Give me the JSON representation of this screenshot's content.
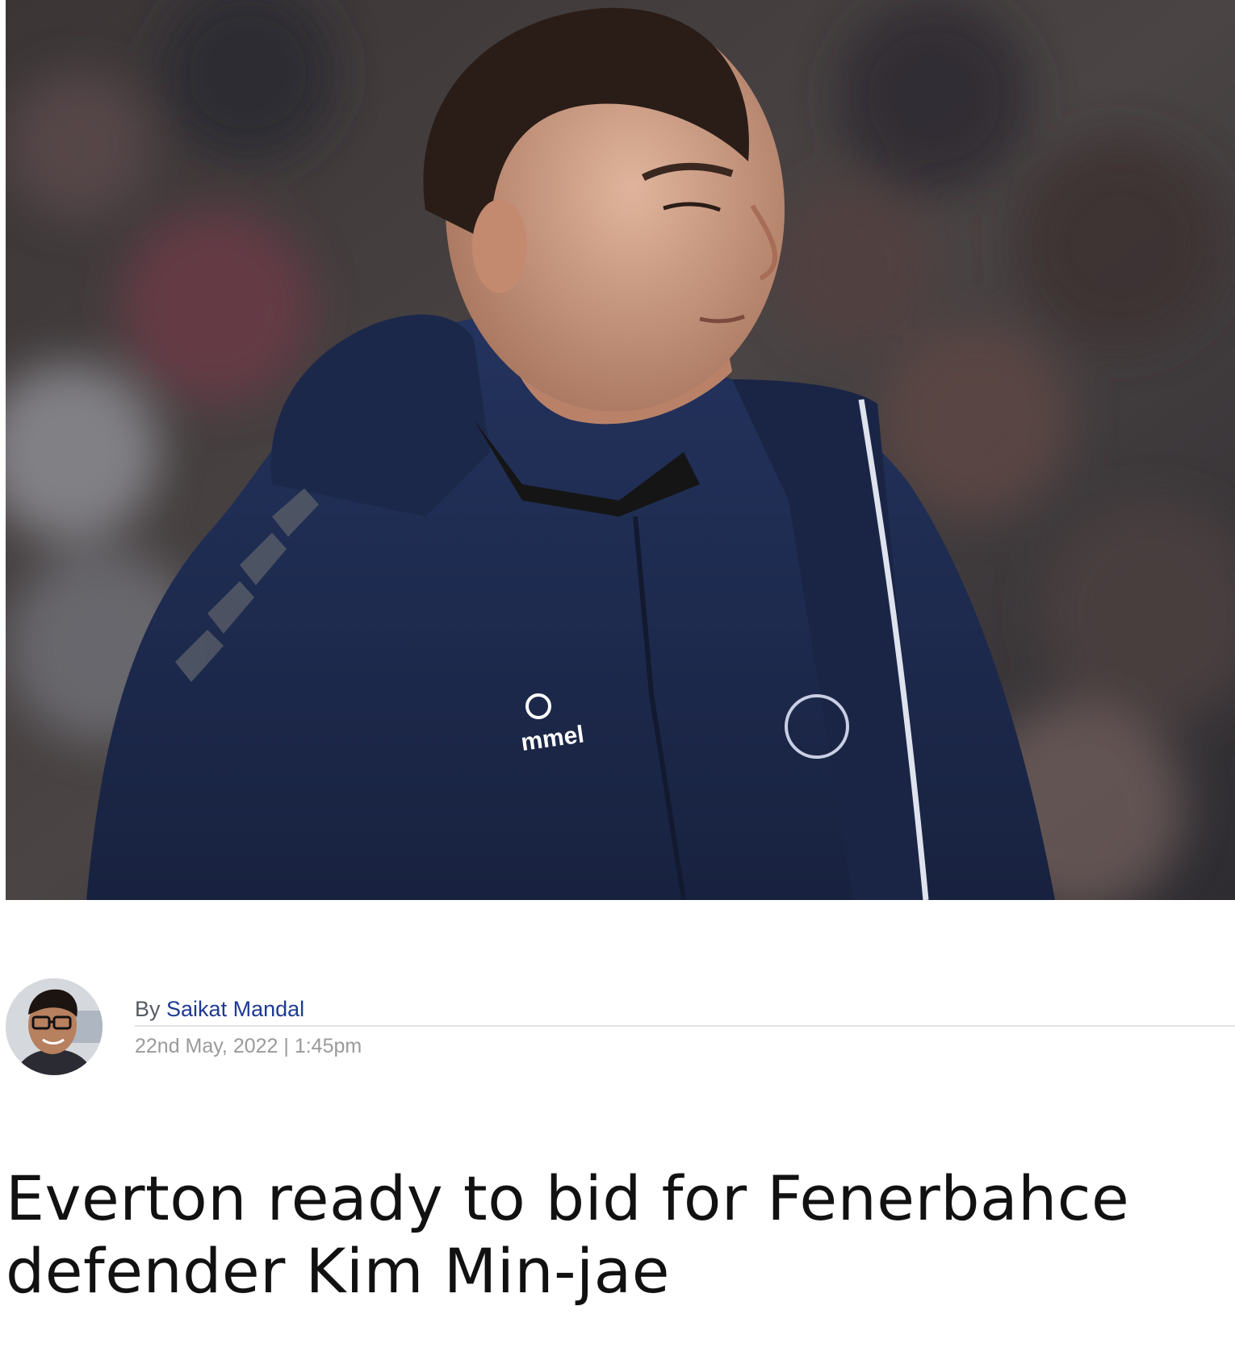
{
  "article": {
    "hero_image_alt": "Man in navy hooded training jacket looking to the side in front of a blurred crowd",
    "jacket_brand": "mmel",
    "byline": {
      "prefix": "By",
      "author": "Saikat Mandal",
      "date": "22nd May, 2022 | 1:45pm"
    },
    "headline": "Everton ready to bid for Fenerbahce defender Kim Min-jae"
  },
  "colors": {
    "author_link": "#1f3a93",
    "meta_text": "#9a9a9a",
    "headline_text": "#111111",
    "jacket_navy": "#1e2b50"
  },
  "icons": {
    "avatar": "author-avatar"
  }
}
